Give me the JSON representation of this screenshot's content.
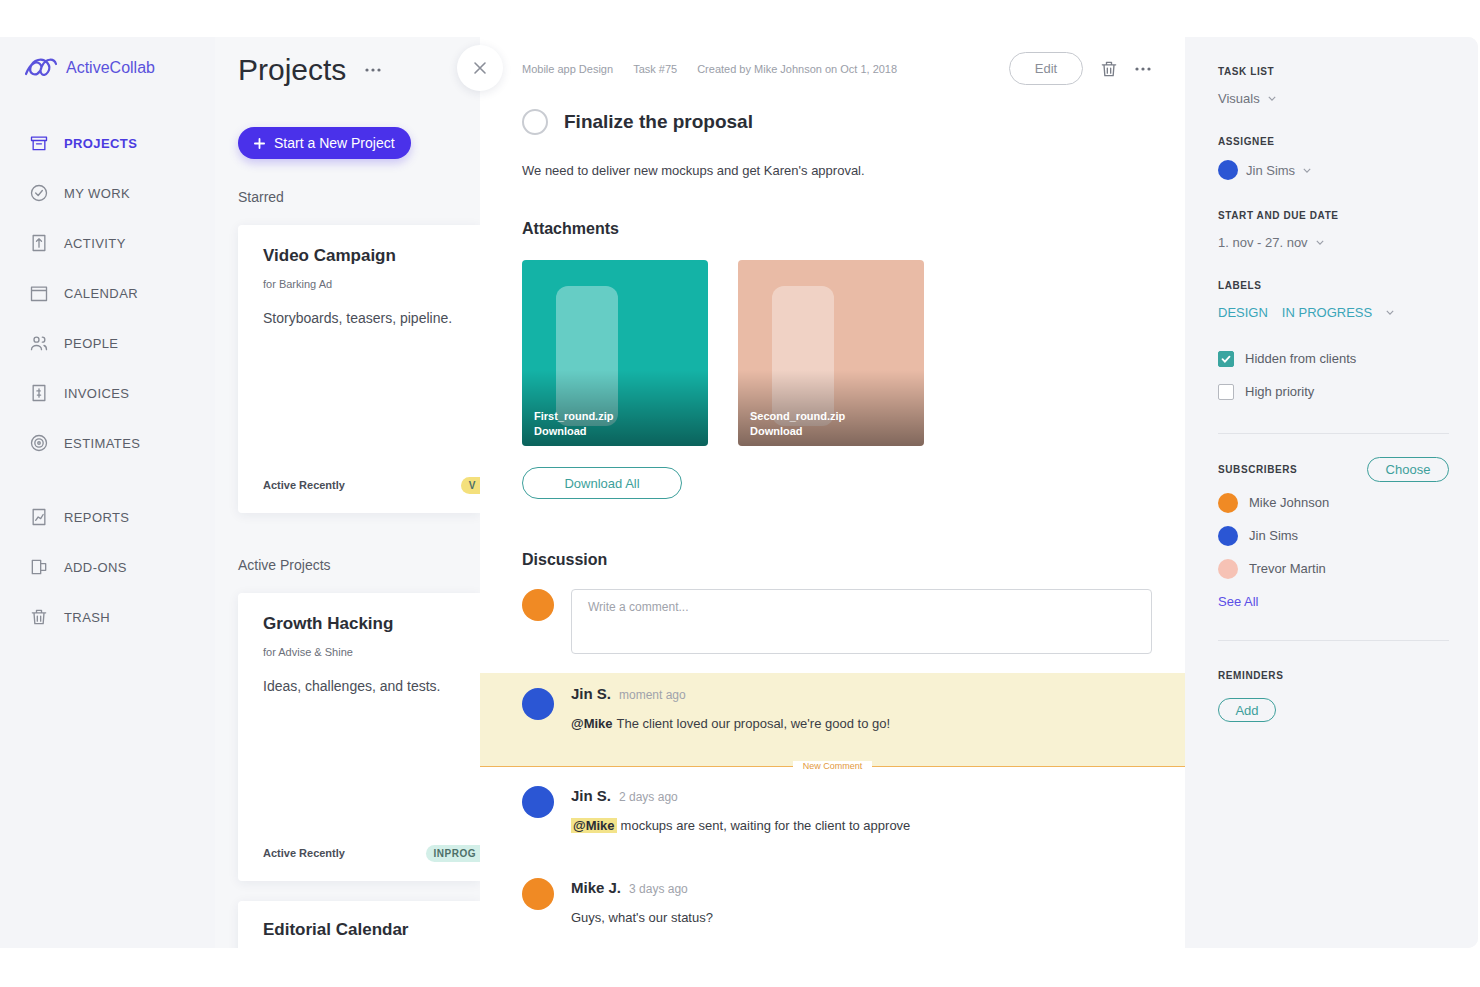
{
  "app": {
    "logo": "ActiveCollab"
  },
  "sidebar": {
    "primary": [
      {
        "label": "PROJECTS",
        "selected": true
      },
      {
        "label": "MY WORK",
        "selected": false
      },
      {
        "label": "ACTIVITY",
        "selected": false
      },
      {
        "label": "CALENDAR",
        "selected": false
      },
      {
        "label": "PEOPLE",
        "selected": false
      },
      {
        "label": "INVOICES",
        "selected": false
      },
      {
        "label": "ESTIMATES",
        "selected": false
      }
    ],
    "secondary": [
      {
        "label": "REPORTS",
        "selected": false
      },
      {
        "label": "ADD-ONS",
        "selected": false
      },
      {
        "label": "TRASH",
        "selected": false
      }
    ]
  },
  "projects": {
    "title": "Projects",
    "new_button": "Start a New Project",
    "groups": [
      {
        "heading": "Starred",
        "cards": [
          {
            "name": "Video Campaign",
            "client": "for Barking Ad",
            "description": "Storyboards, teasers, pipeline.",
            "activity": "Active Recently",
            "badge": "V",
            "color": "#f4e07c"
          }
        ]
      },
      {
        "heading": "Active Projects",
        "cards": [
          {
            "name": "Growth Hacking",
            "client": "for Advise & Shine",
            "description": "Ideas, challenges, and tests.",
            "activity": "Active Recently",
            "badge": "INPROG",
            "color": "#d3efe8"
          },
          {
            "name": "Editorial Calendar"
          }
        ]
      }
    ]
  },
  "task": {
    "breadcrumb": [
      "Mobile app Design",
      "Task #75",
      "Created by Mike Johnson on Oct 1, 2018"
    ],
    "edit_button": "Edit",
    "completed": false,
    "title": "Finalize the proposal",
    "description": "We need to deliver new mockups and get Karen's approval.",
    "attachments_heading": "Attachments",
    "attachments": [
      {
        "name": "First_round.zip",
        "action": "Download",
        "color": "#14b3a6"
      },
      {
        "name": "Second_round.zip",
        "action": "Download",
        "color": "#e9bba6"
      }
    ],
    "download_all": "Download All",
    "discussion_heading": "Discussion",
    "composer": {
      "placeholder": "Write a comment...",
      "color": "#f08a24"
    },
    "new_comment_label": "New Comment",
    "comments": [
      {
        "author": "Jin S.",
        "time": "moment ago",
        "mention": "@Mike",
        "mention_highlighted": false,
        "text": "The client loved our proposal, we're good to go!",
        "highlighted": true,
        "color": "#2b56d4"
      },
      {
        "author": "Jin S.",
        "time": "2 days ago",
        "mention": "@Mike",
        "mention_highlighted": true,
        "text": "mockups are sent, waiting for the client to approve",
        "highlighted": false,
        "color": "#2b56d4"
      },
      {
        "author": "Mike J.",
        "time": "3 days ago",
        "text": "Guys, what's our status?",
        "highlighted": false,
        "color": "#f08a24"
      }
    ]
  },
  "details": {
    "task_list": {
      "label": "TASK LIST",
      "value": "Visuals"
    },
    "assignee": {
      "label": "ASSIGNEE",
      "value": "Jin Sims",
      "color": "#2b56d4"
    },
    "dates": {
      "label": "START AND DUE DATE",
      "value": "1. nov - 27. nov"
    },
    "labels": {
      "label": "LABELS",
      "items": [
        "DESIGN",
        "IN PROGRESS"
      ]
    },
    "options": [
      {
        "label": "Hidden from clients",
        "checked": true
      },
      {
        "label": "High priority",
        "checked": false
      }
    ],
    "subscribers": {
      "label": "SUBSCRIBERS",
      "button": "Choose",
      "people": [
        {
          "name": "Mike Johnson",
          "color": "#f08a24"
        },
        {
          "name": "Jin Sims",
          "color": "#2b56d4"
        },
        {
          "name": "Trevor Martin",
          "color": "#f6c2b5"
        }
      ],
      "see_all": "See All"
    },
    "reminders": {
      "label": "REMINDERS",
      "button": "Add"
    }
  }
}
